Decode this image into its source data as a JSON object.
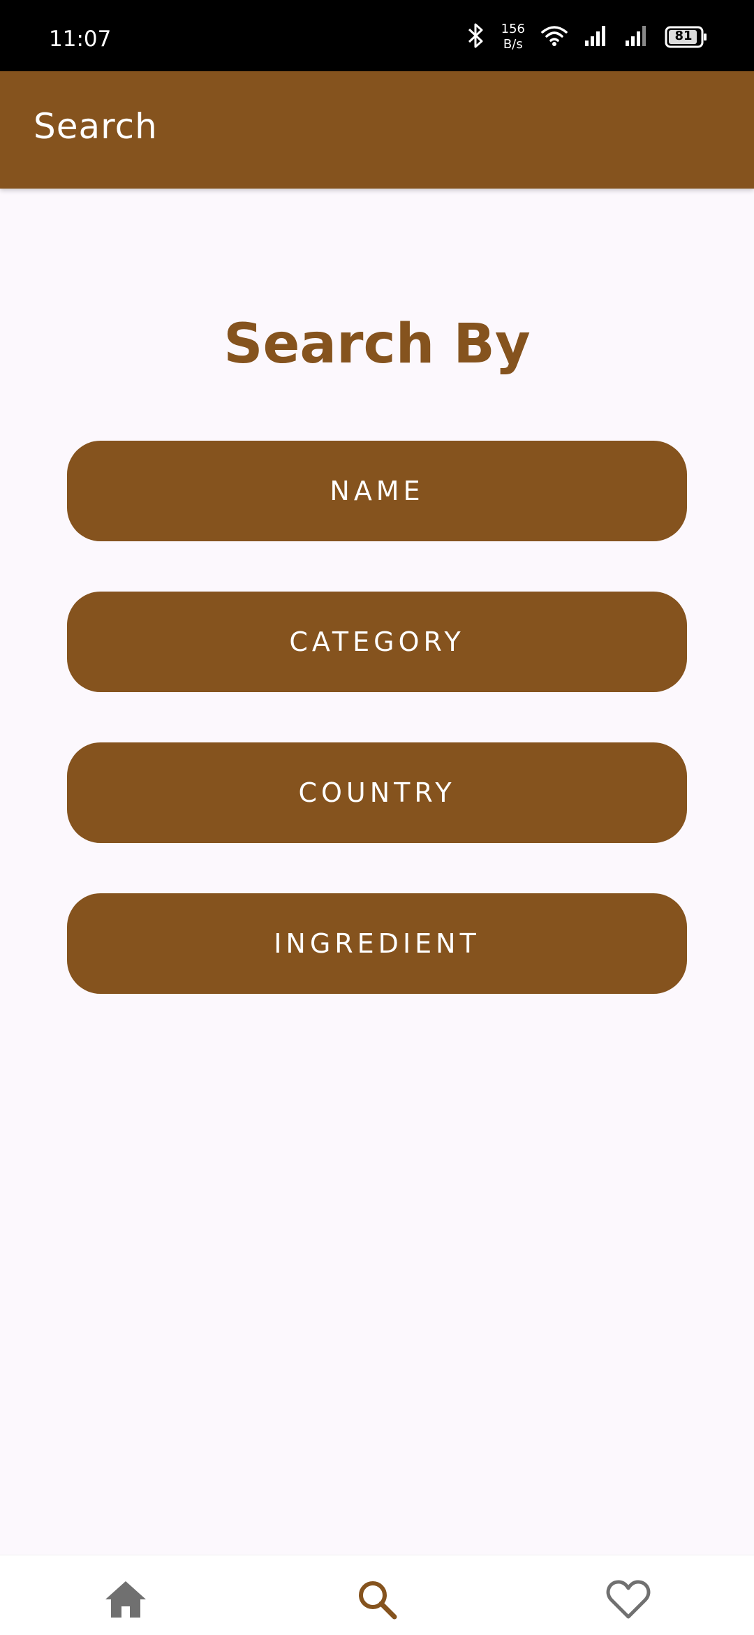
{
  "status_bar": {
    "time": "11:07",
    "net_speed_value": "156",
    "net_speed_unit": "B/s",
    "battery": "81",
    "icons": [
      "bluetooth-icon",
      "wifi-icon",
      "signal-icon",
      "signal-icon",
      "battery-icon"
    ]
  },
  "app_bar": {
    "title": "Search"
  },
  "main": {
    "heading": "Search By",
    "buttons": [
      {
        "label": "NAME"
      },
      {
        "label": "CATEGORY"
      },
      {
        "label": "COUNTRY"
      },
      {
        "label": "INGREDIENT"
      }
    ]
  },
  "bottom_nav": {
    "items": [
      {
        "icon": "home-icon",
        "selected": false
      },
      {
        "icon": "search-icon",
        "selected": true
      },
      {
        "icon": "heart-icon",
        "selected": false
      }
    ]
  },
  "colors": {
    "primary": "#85531e",
    "background": "#fcf8fd",
    "nav_inactive": "#707070"
  }
}
